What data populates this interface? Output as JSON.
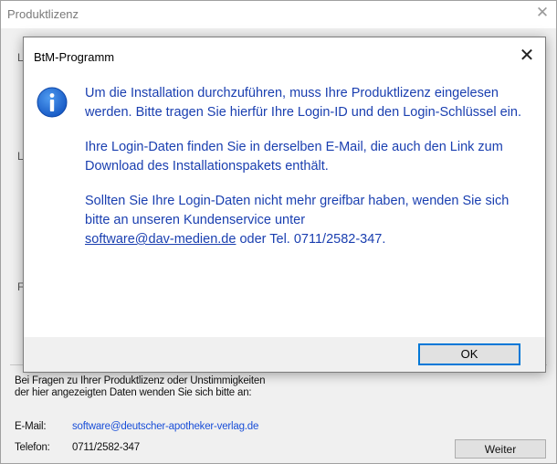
{
  "background_window": {
    "title": "Produktlizenz",
    "close_glyph": "✕",
    "fragments": [
      "L",
      "L",
      "F"
    ],
    "help_text_line1": "Bei Fragen zu Ihrer Produktlizenz oder Unstimmigkeiten",
    "help_text_line2": "der hier angezeigten Daten wenden Sie sich bitte an:",
    "email_label": "E-Mail:",
    "email_value": "software@deutscher-apotheker-verlag.de",
    "phone_label": "Telefon:",
    "phone_value": "0711/2582-347",
    "next_button": "Weiter"
  },
  "dialog": {
    "title": "BtM-Programm",
    "close_glyph": "✕",
    "icon": "info-icon",
    "paragraph1": "Um die Installation durchzuführen, muss Ihre Produktlizenz eingelesen werden. Bitte tragen Sie hierfür Ihre Login-ID und den Login-Schlüssel ein.",
    "paragraph2": "Ihre Login-Daten finden Sie in derselben E-Mail, die auch den Link zum Download des Installationspakets enthält.",
    "paragraph3_text": "Sollten Sie Ihre Login-Daten nicht mehr greifbar haben, wenden Sie sich bitte an unseren Kundenservice unter",
    "paragraph3_link": "software@dav-medien.de",
    "paragraph3_suffix": " oder Tel. 0711/2582-347.",
    "ok_button": "OK"
  },
  "colors": {
    "message_text": "#1a3fb0",
    "link": "#1a4fd8",
    "focus_border": "#0078d7"
  }
}
